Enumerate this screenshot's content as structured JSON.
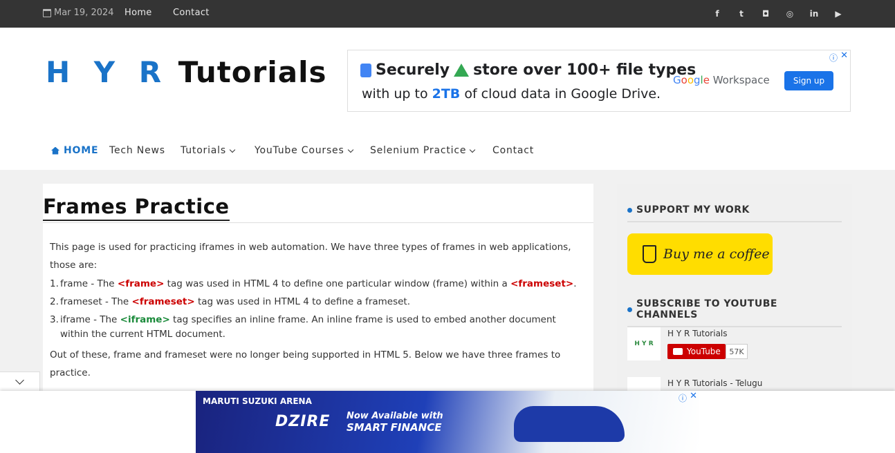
{
  "topbar": {
    "date": "Mar 19, 2024",
    "links": [
      "Home",
      "Contact"
    ],
    "social_icons": [
      "facebook-icon",
      "twitter-icon",
      "github-icon",
      "instagram-icon",
      "linkedin-icon",
      "youtube-icon"
    ]
  },
  "header": {
    "logo_part1": "H Y R",
    "logo_part2": "Tutorials"
  },
  "ad_top": {
    "line1_a": "Securely",
    "line1_b": "store over 100+ file types",
    "line2_a": "with up to ",
    "line2_b": "2TB",
    "line2_c": " of cloud data in Google Drive.",
    "brand_google": [
      "G",
      "o",
      "o",
      "g",
      "l",
      "e"
    ],
    "brand_workspace": "Workspace",
    "cta": "Sign up"
  },
  "nav": {
    "items": [
      {
        "label": "HOME"
      },
      {
        "label": "Tech News"
      },
      {
        "label": "Tutorials"
      },
      {
        "label": "YouTube Courses"
      },
      {
        "label": "Selenium Practice"
      },
      {
        "label": "Contact"
      }
    ]
  },
  "content": {
    "title": "Frames Practice",
    "intro": "This page is used for practicing iframes in web automation. We have three types of frames in web applications, those are:",
    "list": [
      {
        "num": "1.",
        "pre": "frame - The ",
        "tag1": "<frame>",
        "mid": " tag was used in HTML 4 to define one particular window (frame) within a ",
        "tag2": "<frameset>",
        "post": "."
      },
      {
        "num": "2.",
        "pre": "frameset - The ",
        "tag1": "<frameset>",
        "mid": " tag was used in HTML 4 to define a frameset."
      },
      {
        "num": "3.",
        "pre": "iframe - The ",
        "tag1": "<iframe>",
        "mid": " tag specifies an inline frame. An inline frame is used to embed another document within the current HTML document."
      }
    ],
    "outro": "Out of these, frame and frameset were no longer being supported in HTML 5. Below we have three frames to practice."
  },
  "sidebar": {
    "support_heading": "SUPPORT MY WORK",
    "coffee_label": "Buy me a coffee",
    "youtube_heading": "SUBSCRIBE TO YOUTUBE CHANNELS",
    "channels": [
      {
        "name": "H Y R Tutorials",
        "button": "YouTube",
        "subs": "57K",
        "thumb": "H Y R"
      },
      {
        "name": "H Y R Tutorials - Telugu"
      }
    ]
  },
  "ad_bottom": {
    "brand": "MARUTI SUZUKI ARENA",
    "model": "DZIRE",
    "tag1": "Now Available with",
    "tag2": "SMART FINANCE"
  }
}
